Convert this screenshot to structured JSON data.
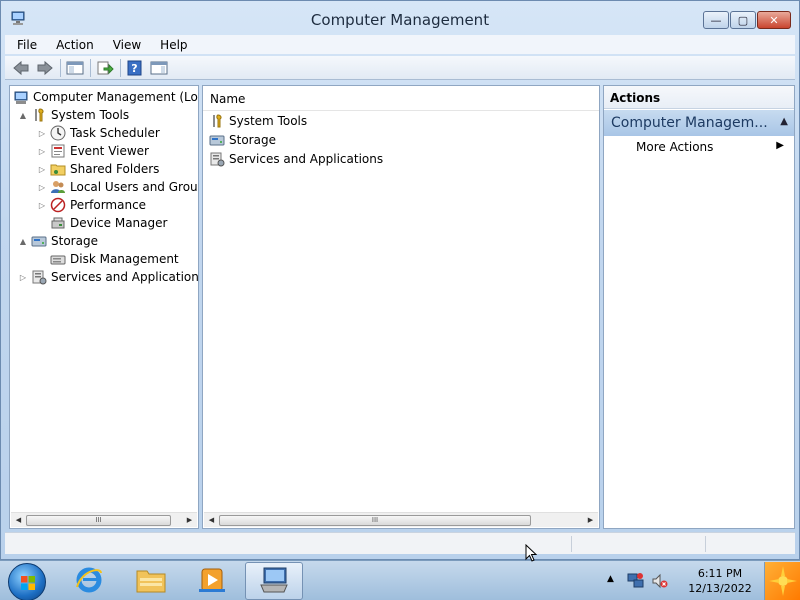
{
  "window": {
    "title": "Computer Management",
    "controls": {
      "minimize": "—",
      "maximize": "▢",
      "close": "✕"
    }
  },
  "menu": [
    "File",
    "Action",
    "View",
    "Help"
  ],
  "toolbar": {
    "buttons": [
      "back-icon",
      "forward-icon",
      "show-hide-console-tree-icon",
      "export-list-icon",
      "help-icon",
      "show-hide-action-pane-icon"
    ]
  },
  "tree": {
    "root": "Computer Management (Local",
    "items": [
      {
        "label": "System Tools",
        "level": 1,
        "expander": "▲",
        "icon": "tools-icon"
      },
      {
        "label": "Task Scheduler",
        "level": 2,
        "expander": "▷",
        "icon": "clock-icon"
      },
      {
        "label": "Event Viewer",
        "level": 2,
        "expander": "▷",
        "icon": "event-viewer-icon"
      },
      {
        "label": "Shared Folders",
        "level": 2,
        "expander": "▷",
        "icon": "shared-folder-icon"
      },
      {
        "label": "Local Users and Groups",
        "level": 2,
        "expander": "▷",
        "icon": "users-icon"
      },
      {
        "label": "Performance",
        "level": 2,
        "expander": "▷",
        "icon": "performance-icon"
      },
      {
        "label": "Device Manager",
        "level": 2,
        "expander": "",
        "icon": "device-manager-icon"
      },
      {
        "label": "Storage",
        "level": 1,
        "expander": "▲",
        "icon": "storage-icon"
      },
      {
        "label": "Disk Management",
        "level": 2,
        "expander": "",
        "icon": "disk-icon"
      },
      {
        "label": "Services and Applications",
        "level": 1,
        "expander": "▷",
        "icon": "services-icon"
      }
    ]
  },
  "list": {
    "column_header": "Name",
    "items": [
      "System Tools",
      "Storage",
      "Services and Applications"
    ]
  },
  "actions": {
    "header": "Actions",
    "section": "Computer Managem...",
    "items": [
      "More Actions"
    ]
  },
  "scrollbar": {
    "grip": "III",
    "left_arrow": "◀",
    "right_arrow": "▶"
  },
  "taskbar": {
    "time": "6:11 PM",
    "date": "12/13/2022",
    "tray_expand": "▲"
  }
}
